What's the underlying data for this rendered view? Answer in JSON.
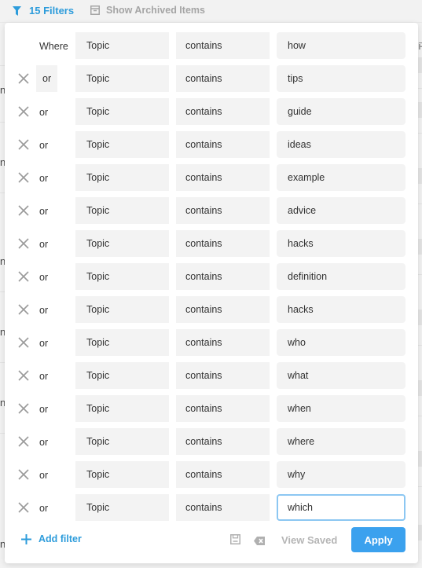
{
  "toolbar": {
    "filters_label": "15 Filters",
    "filter_icon": "funnel-icon",
    "archived_label": "Show Archived Items",
    "archived_icon": "archive-box-icon"
  },
  "colors": {
    "accent": "#2d9cdb",
    "apply_bg": "#3ba1ee",
    "field_bg": "#f3f3f3",
    "focus_border": "#8cc7f2",
    "muted": "#a5a5a5"
  },
  "filters": [
    {
      "conjunction": "Where",
      "field": "Topic",
      "operator": "contains",
      "value": "how"
    },
    {
      "conjunction": "or",
      "field": "Topic",
      "operator": "contains",
      "value": "tips"
    },
    {
      "conjunction": "or",
      "field": "Topic",
      "operator": "contains",
      "value": "guide"
    },
    {
      "conjunction": "or",
      "field": "Topic",
      "operator": "contains",
      "value": "ideas"
    },
    {
      "conjunction": "or",
      "field": "Topic",
      "operator": "contains",
      "value": "example"
    },
    {
      "conjunction": "or",
      "field": "Topic",
      "operator": "contains",
      "value": "advice"
    },
    {
      "conjunction": "or",
      "field": "Topic",
      "operator": "contains",
      "value": "hacks"
    },
    {
      "conjunction": "or",
      "field": "Topic",
      "operator": "contains",
      "value": "definition"
    },
    {
      "conjunction": "or",
      "field": "Topic",
      "operator": "contains",
      "value": "hacks"
    },
    {
      "conjunction": "or",
      "field": "Topic",
      "operator": "contains",
      "value": "who"
    },
    {
      "conjunction": "or",
      "field": "Topic",
      "operator": "contains",
      "value": "what"
    },
    {
      "conjunction": "or",
      "field": "Topic",
      "operator": "contains",
      "value": "when"
    },
    {
      "conjunction": "or",
      "field": "Topic",
      "operator": "contains",
      "value": "where"
    },
    {
      "conjunction": "or",
      "field": "Topic",
      "operator": "contains",
      "value": "why"
    },
    {
      "conjunction": "or",
      "field": "Topic",
      "operator": "contains",
      "value": "which"
    }
  ],
  "footer": {
    "add_filter_label": "Add filter",
    "save_icon": "floppy-disk-icon",
    "clear_icon": "backspace-clear-icon",
    "view_saved_label": "View Saved",
    "apply_label": "Apply"
  },
  "background": {
    "right_header_fragment": "P",
    "left_text_fragment": "n"
  }
}
